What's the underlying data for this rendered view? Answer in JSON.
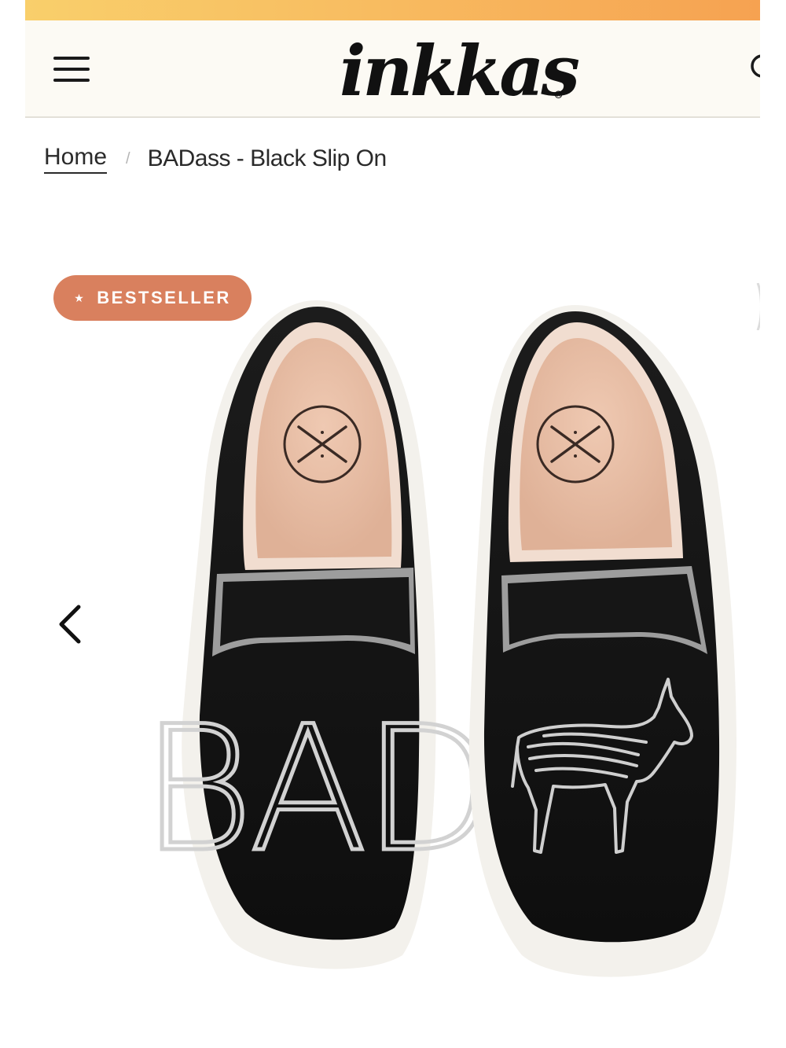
{
  "header": {
    "menu_icon": "hamburger-menu-icon",
    "logo_text": "inkkas",
    "logo_mark": "®",
    "search_icon": "search-icon"
  },
  "breadcrumb": {
    "home_label": "Home",
    "separator": "/",
    "current_label": "BADass - Black Slip On"
  },
  "product_gallery": {
    "badge_star": "★",
    "badge_label": "BESTSELLER",
    "prev_icon": "chevron-left-icon",
    "left_shoe_print": "BAD",
    "right_shoe_print_icon": "donkey-icon",
    "insole_logo_icon": "crossed-needles-icon"
  },
  "colors": {
    "promo_gradient_start": "#f9cf6b",
    "promo_gradient_end": "#f6a251",
    "header_bg": "#fcfaf4",
    "badge_bg": "#d9805e",
    "shoe_canvas": "#151515",
    "shoe_sole": "#f3f1ec",
    "insole": "#e8bfa6"
  }
}
